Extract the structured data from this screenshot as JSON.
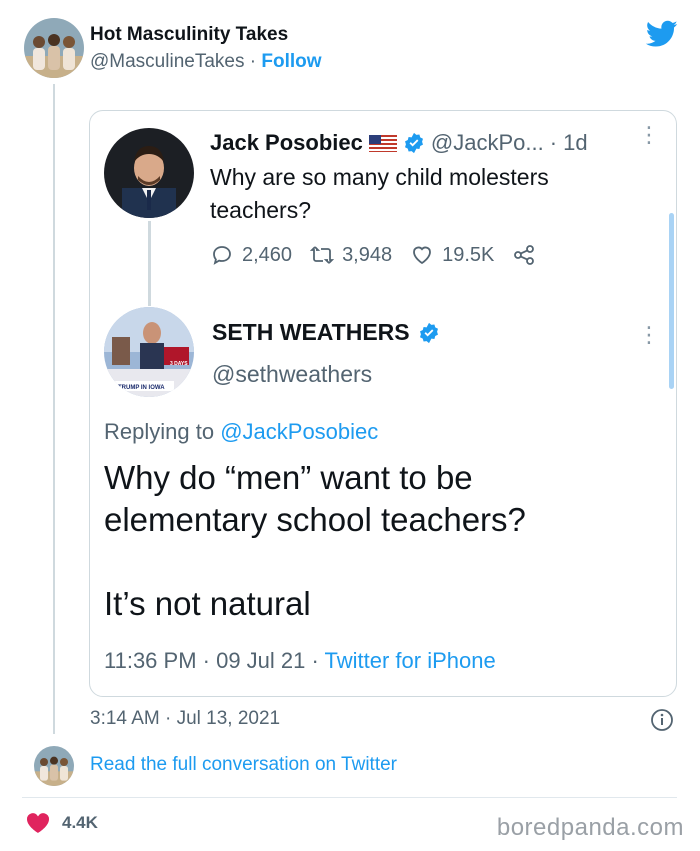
{
  "outer": {
    "name": "Hot Masculinity Takes",
    "handle": "@MasculineTakes",
    "separator": "·",
    "follow_label": "Follow",
    "timestamp": "3:14 AM · Jul 13, 2021",
    "read_full_label": "Read the full conversation on Twitter",
    "likes": "4.4K",
    "logo_icon": "twitter-bird-icon",
    "accent_color": "#1d9bf0",
    "like_color": "#e0245e"
  },
  "quoted": {
    "first_tweet": {
      "name": "Jack Posobiec",
      "handle": "@JackPo...",
      "time": "· 1d",
      "text": "Why are so many child molesters teachers?",
      "replies": "2,460",
      "retweets": "3,948",
      "likes": "19.5K"
    },
    "reply_tweet": {
      "name": "SETH WEATHERS",
      "handle": "@sethweathers",
      "replying_prefix": "Replying to",
      "replying_to": "@JackPosobiec",
      "text": "Why do “men” want to be\nelementary school teachers?\n\nIt’s not natural",
      "timestamp": "11:36 PM · 09 Jul 21 ·",
      "source": "Twitter for iPhone",
      "avatar_caption": "OF TRUMP IN IOWA",
      "avatar_badge": "3 DAYS"
    }
  },
  "watermark": "boredpanda.com"
}
